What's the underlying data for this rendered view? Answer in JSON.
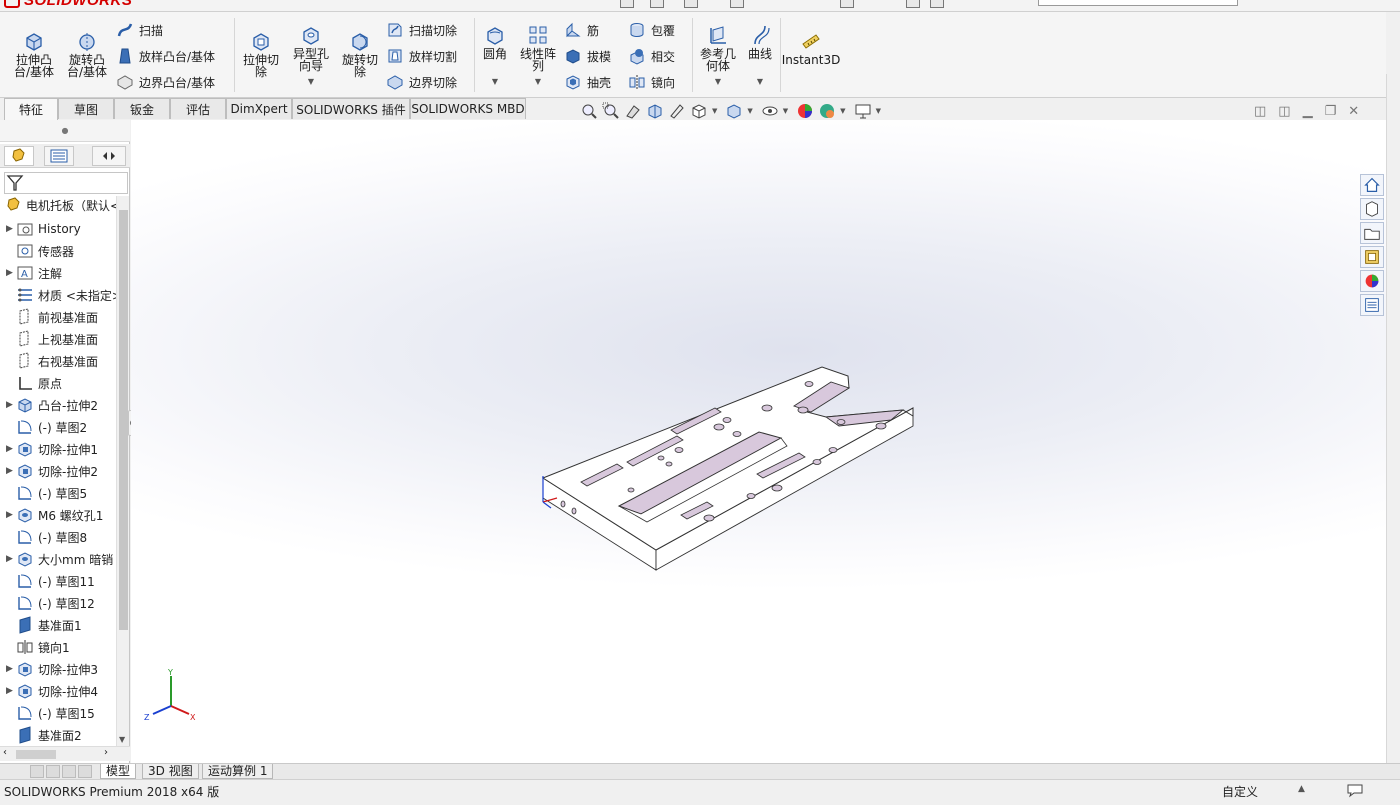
{
  "app": {
    "logo_text": "SOLIDWORKS"
  },
  "command_manager": {
    "big_tools": [
      {
        "label": "拉伸凸\n台/基体",
        "icon": "extrude-boss-icon"
      },
      {
        "label": "旋转凸\n台/基体",
        "icon": "revolve-boss-icon"
      },
      {
        "label": "拉伸切\n除",
        "icon": "extrude-cut-icon"
      },
      {
        "label": "异型孔\n向导",
        "icon": "hole-wizard-icon"
      },
      {
        "label": "旋转切\n除",
        "icon": "revolve-cut-icon"
      },
      {
        "label": "圆角",
        "icon": "fillet-icon"
      },
      {
        "label": "线性阵\n列",
        "icon": "linear-pattern-icon"
      },
      {
        "label": "参考几\n何体",
        "icon": "reference-geometry-icon"
      },
      {
        "label": "曲线",
        "icon": "curves-icon"
      },
      {
        "label": "Instant3D",
        "icon": "instant3d-icon"
      }
    ],
    "boss_rows": [
      "扫描",
      "放样凸台/基体",
      "边界凸台/基体"
    ],
    "cut_rows": [
      "扫描切除",
      "放样切割",
      "边界切除"
    ],
    "feature_rows_a": [
      "筋",
      "拔模",
      "抽壳"
    ],
    "feature_rows_b": [
      "包覆",
      "相交",
      "镜向"
    ]
  },
  "tabs": [
    "特征",
    "草图",
    "钣金",
    "评估",
    "DimXpert",
    "SOLIDWORKS 插件",
    "SOLIDWORKS MBD"
  ],
  "active_tab": "特征",
  "feature_tree": {
    "root": "电机托板（默认<",
    "items": [
      {
        "label": "History",
        "expandable": true,
        "icon": "history-folder-icon"
      },
      {
        "label": "传感器",
        "expandable": false,
        "icon": "sensors-icon"
      },
      {
        "label": "注解",
        "expandable": true,
        "icon": "annotations-icon"
      },
      {
        "label": "材质 <未指定>",
        "expandable": false,
        "icon": "material-icon"
      },
      {
        "label": "前视基准面",
        "expandable": false,
        "icon": "plane-icon"
      },
      {
        "label": "上视基准面",
        "expandable": false,
        "icon": "plane-icon"
      },
      {
        "label": "右视基准面",
        "expandable": false,
        "icon": "plane-icon"
      },
      {
        "label": "原点",
        "expandable": false,
        "icon": "origin-icon"
      },
      {
        "label": "凸台-拉伸2",
        "expandable": true,
        "icon": "boss-extrude-icon"
      },
      {
        "label": "(-) 草图2",
        "expandable": false,
        "icon": "sketch-icon"
      },
      {
        "label": "切除-拉伸1",
        "expandable": true,
        "icon": "cut-extrude-icon"
      },
      {
        "label": "切除-拉伸2",
        "expandable": true,
        "icon": "cut-extrude-icon"
      },
      {
        "label": "(-) 草图5",
        "expandable": false,
        "icon": "sketch-icon"
      },
      {
        "label": "M6 螺纹孔1",
        "expandable": true,
        "icon": "hole-icon"
      },
      {
        "label": "(-) 草图8",
        "expandable": false,
        "icon": "sketch-icon"
      },
      {
        "label": "大小mm 暗销",
        "expandable": true,
        "icon": "hole-icon"
      },
      {
        "label": "(-) 草图11",
        "expandable": false,
        "icon": "sketch-icon"
      },
      {
        "label": "(-) 草图12",
        "expandable": false,
        "icon": "sketch-icon"
      },
      {
        "label": "基准面1",
        "expandable": false,
        "icon": "ref-plane-icon"
      },
      {
        "label": "镜向1",
        "expandable": false,
        "icon": "mirror-icon"
      },
      {
        "label": "切除-拉伸3",
        "expandable": true,
        "icon": "cut-extrude-icon"
      },
      {
        "label": "切除-拉伸4",
        "expandable": true,
        "icon": "cut-extrude-icon"
      },
      {
        "label": "(-) 草图15",
        "expandable": false,
        "icon": "sketch-icon"
      },
      {
        "label": "基准面2",
        "expandable": false,
        "icon": "ref-plane-icon"
      }
    ]
  },
  "bottom_tabs": [
    "模型",
    "3D 视图",
    "运动算例 1"
  ],
  "active_bottom_tab": "模型",
  "status": {
    "product": "SOLIDWORKS Premium 2018 x64 版",
    "custom": "自定义"
  },
  "triad": {
    "x": "X",
    "y": "Y",
    "z": "Z"
  },
  "colors": {
    "part_face": "#ffffff",
    "part_wall": "#d8c8dc",
    "part_edge": "#333333",
    "brand_red": "#d40000",
    "icon_blue": "#3b6fb6"
  }
}
